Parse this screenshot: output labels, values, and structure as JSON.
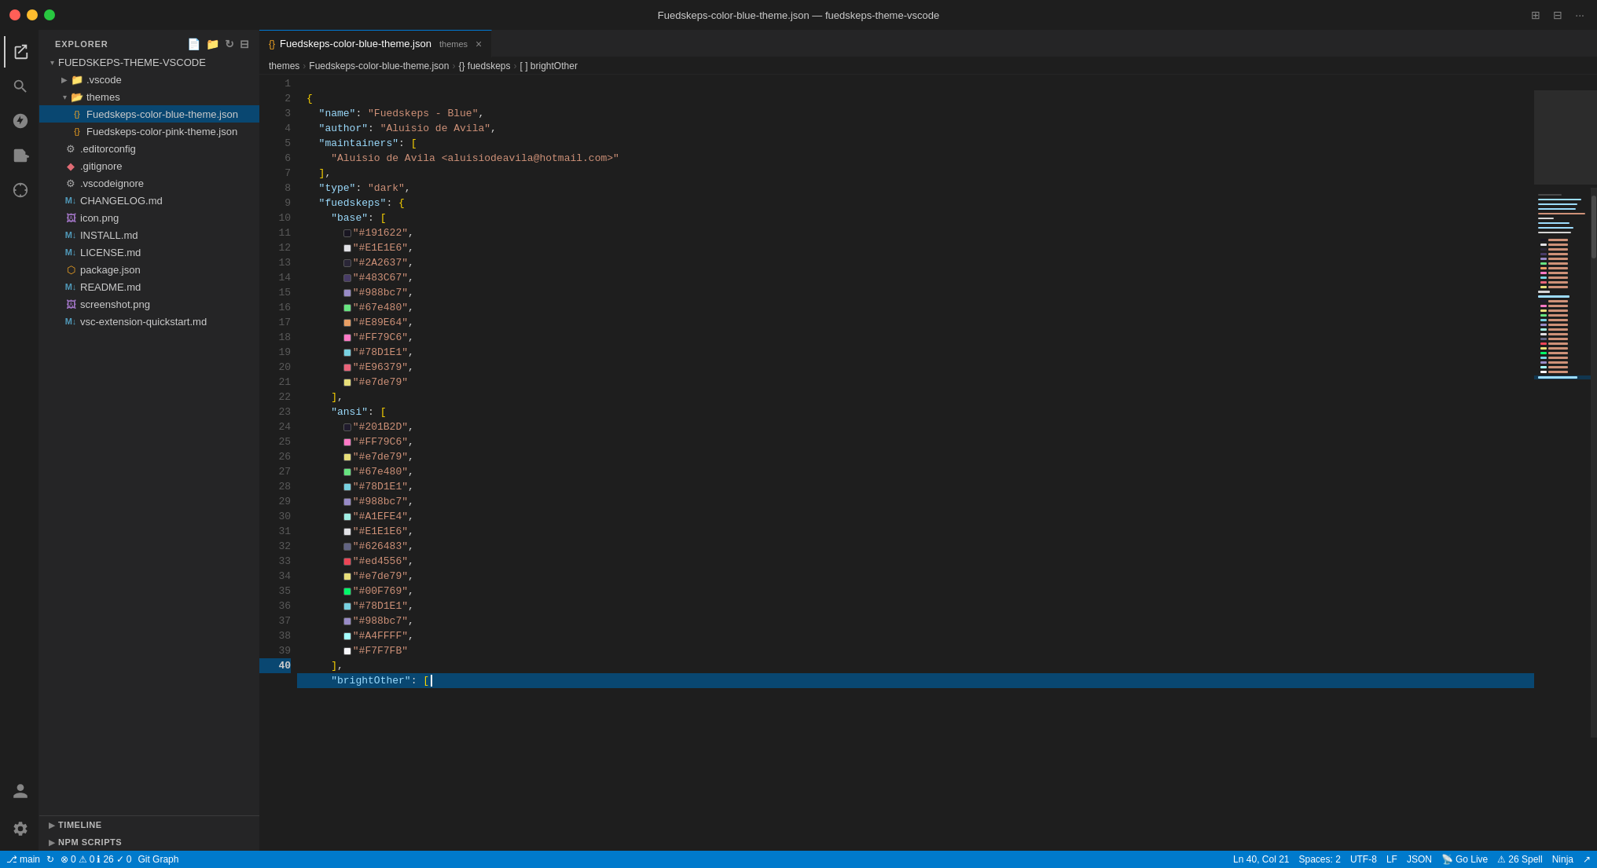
{
  "titleBar": {
    "title": "Fuedskeps-color-blue-theme.json — fuedskeps-theme-vscode"
  },
  "tabs": [
    {
      "id": "fuedskeps-blue",
      "icon": "{}",
      "label": "Fuedskeps-color-blue-theme.json",
      "tag": "themes",
      "active": true,
      "closeable": true
    }
  ],
  "breadcrumb": [
    {
      "label": "themes"
    },
    {
      "label": "Fuedskeps-color-blue-theme.json"
    },
    {
      "label": "{} fuedskeps"
    },
    {
      "label": "[ ] brightOther"
    }
  ],
  "sidebar": {
    "title": "EXPLORER",
    "rootLabel": "FUEDSKEPS-THEME-VSCODE",
    "items": [
      {
        "type": "dir",
        "label": ".vscode",
        "depth": 1,
        "collapsed": true
      },
      {
        "type": "dir",
        "label": "themes",
        "depth": 1,
        "collapsed": false
      },
      {
        "type": "file",
        "label": "Fuedskeps-color-blue-theme.json",
        "depth": 2,
        "icon": "{}",
        "iconColor": "#f5a623",
        "active": true
      },
      {
        "type": "file",
        "label": "Fuedskeps-color-pink-theme.json",
        "depth": 2,
        "icon": "{}",
        "iconColor": "#f5a623"
      },
      {
        "type": "file",
        "label": ".editorconfig",
        "depth": 1,
        "icon": "⚙",
        "iconColor": "#aaaaaa"
      },
      {
        "type": "file",
        "label": ".gitignore",
        "depth": 1,
        "icon": "◆",
        "iconColor": "#e06c75"
      },
      {
        "type": "file",
        "label": ".vscodeignore",
        "depth": 1,
        "icon": "⚙",
        "iconColor": "#aaaaaa"
      },
      {
        "type": "file",
        "label": "CHANGELOG.md",
        "depth": 1,
        "icon": "M",
        "iconColor": "#519aba"
      },
      {
        "type": "file",
        "label": "icon.png",
        "depth": 1,
        "icon": "🖼",
        "iconColor": "#a074c4"
      },
      {
        "type": "file",
        "label": "INSTALL.md",
        "depth": 1,
        "icon": "M",
        "iconColor": "#519aba"
      },
      {
        "type": "file",
        "label": "LICENSE.md",
        "depth": 1,
        "icon": "M",
        "iconColor": "#519aba"
      },
      {
        "type": "file",
        "label": "package.json",
        "depth": 1,
        "icon": "{}",
        "iconColor": "#f5a623"
      },
      {
        "type": "file",
        "label": "README.md",
        "depth": 1,
        "icon": "M",
        "iconColor": "#519aba"
      },
      {
        "type": "file",
        "label": "screenshot.png",
        "depth": 1,
        "icon": "🖼",
        "iconColor": "#a074c4"
      },
      {
        "type": "file",
        "label": "vsc-extension-quickstart.md",
        "depth": 1,
        "icon": "M",
        "iconColor": "#519aba"
      }
    ],
    "bottomSections": [
      {
        "label": "TIMELINE"
      },
      {
        "label": "NPM SCRIPTS"
      }
    ]
  },
  "editor": {
    "lines": [
      {
        "n": 1,
        "code": "{"
      },
      {
        "n": 2,
        "code": "  \"name\": \"Fuedskeps - Blue\","
      },
      {
        "n": 3,
        "code": "  \"author\": \"Aluisio de Avila\","
      },
      {
        "n": 4,
        "code": "  \"maintainers\": ["
      },
      {
        "n": 5,
        "code": "    \"Aluisio de Avila <aluisiodeavila@hotmail.com>\""
      },
      {
        "n": 6,
        "code": "  ],"
      },
      {
        "n": 7,
        "code": "  \"type\": \"dark\","
      },
      {
        "n": 8,
        "code": "  \"fuedskeps\": {"
      },
      {
        "n": 9,
        "code": "    \"base\": ["
      },
      {
        "n": 10,
        "code": "      \"#191622\","
      },
      {
        "n": 11,
        "code": "      \"#E1E1E6\","
      },
      {
        "n": 12,
        "code": "      \"#2A2637\","
      },
      {
        "n": 13,
        "code": "      \"#483C67\","
      },
      {
        "n": 14,
        "code": "      \"#988bc7\","
      },
      {
        "n": 15,
        "code": "      \"#67e480\","
      },
      {
        "n": 16,
        "code": "      \"#E89E64\","
      },
      {
        "n": 17,
        "code": "      \"#FF79C6\","
      },
      {
        "n": 18,
        "code": "      \"#78D1E1\","
      },
      {
        "n": 19,
        "code": "      \"#E96379\","
      },
      {
        "n": 20,
        "code": "      \"#e7de79\""
      },
      {
        "n": 21,
        "code": "    ],"
      },
      {
        "n": 22,
        "code": "    \"ansi\": ["
      },
      {
        "n": 23,
        "code": "      \"#201B2D\","
      },
      {
        "n": 24,
        "code": "      \"#FF79C6\","
      },
      {
        "n": 25,
        "code": "      \"#e7de79\","
      },
      {
        "n": 26,
        "code": "      \"#67e480\","
      },
      {
        "n": 27,
        "code": "      \"#78D1E1\","
      },
      {
        "n": 28,
        "code": "      \"#988bc7\","
      },
      {
        "n": 29,
        "code": "      \"#A1EFE4\","
      },
      {
        "n": 30,
        "code": "      \"#E1E1E6\","
      },
      {
        "n": 31,
        "code": "      \"#626483\","
      },
      {
        "n": 32,
        "code": "      \"#ed4556\","
      },
      {
        "n": 33,
        "code": "      \"#e7de79\","
      },
      {
        "n": 34,
        "code": "      \"#00F769\","
      },
      {
        "n": 35,
        "code": "      \"#78D1E1\","
      },
      {
        "n": 36,
        "code": "      \"#988bc7\","
      },
      {
        "n": 37,
        "code": "      \"#A4FFFF\","
      },
      {
        "n": 38,
        "code": "      \"#F7F7FB\""
      },
      {
        "n": 39,
        "code": "    ],"
      },
      {
        "n": 40,
        "code": "    \"brightOther\": ["
      }
    ],
    "colorSwatches": {
      "10": "#191622",
      "11": "#E1E1E6",
      "12": "#2A2637",
      "13": "#483C67",
      "14": "#988bc7",
      "15": "#67e480",
      "16": "#E89E64",
      "17": "#FF79C6",
      "18": "#78D1E1",
      "19": "#E96379",
      "20": "#e7de79",
      "23": "#201B2D",
      "24": "#FF79C6",
      "25": "#e7de79",
      "26": "#67e480",
      "27": "#78D1E1",
      "28": "#988bc7",
      "29": "#A1EFE4",
      "30": "#E1E1E6",
      "31": "#626483",
      "32": "#ed4556",
      "33": "#e7de79",
      "34": "#00F769",
      "35": "#78D1E1",
      "36": "#988bc7",
      "37": "#A4FFFF",
      "38": "#F7F7FB"
    }
  },
  "statusBar": {
    "branch": "main",
    "syncIcon": "↻",
    "errors": "0",
    "warnings": "0",
    "info": "26",
    "hints": "0",
    "gitGraph": "Git Graph",
    "position": "Ln 40, Col 21",
    "spaces": "Spaces: 2",
    "encoding": "UTF-8",
    "lineEnding": "LF",
    "language": "JSON",
    "goLive": "Go Live",
    "spell": "26 Spell",
    "ninja": "Ninja"
  },
  "activityBar": {
    "icons": [
      "explorer",
      "search",
      "git",
      "extensions",
      "remote"
    ],
    "bottomIcons": [
      "account",
      "settings"
    ]
  }
}
